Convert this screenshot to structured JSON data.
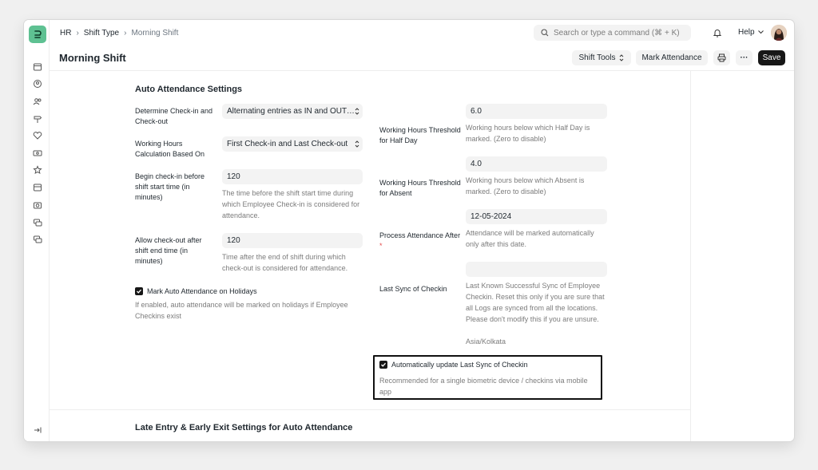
{
  "breadcrumb": [
    "HR",
    "Shift Type",
    "Morning Shift"
  ],
  "search": {
    "placeholder": "Search or type a command (⌘ + K)"
  },
  "help_label": "Help",
  "page_title": "Morning Shift",
  "actions": {
    "shift_tools": "Shift Tools",
    "mark_attendance": "Mark Attendance",
    "more": "···",
    "save": "Save"
  },
  "section": {
    "title": "Auto Attendance Settings",
    "next_title": "Late Entry & Early Exit Settings for Auto Attendance"
  },
  "left_fields": [
    {
      "label": "Determine Check-in and Check-out",
      "value": "Alternating entries as IN and OUT during the same shift"
    },
    {
      "label": "Working Hours Calculation Based On",
      "value": "First Check-in and Last Check-out"
    },
    {
      "label": "Begin check-in before shift start time (in minutes)",
      "value": "120",
      "desc": "The time before the shift start time during which Employee Check-in is considered for attendance."
    },
    {
      "label": "Allow check-out after shift end time (in minutes)",
      "value": "120",
      "desc": "Time after the end of shift during which check-out is considered for attendance."
    }
  ],
  "holiday_check": {
    "label": "Mark Auto Attendance on Holidays",
    "desc": "If enabled, auto attendance will be marked on holidays if Employee Checkins exist"
  },
  "right_fields": [
    {
      "label": "Working Hours Threshold for Half Day",
      "value": "6.0",
      "desc": "Working hours below which Half Day is marked. (Zero to disable)"
    },
    {
      "label": "Working Hours Threshold for Absent",
      "value": "4.0",
      "desc": "Working hours below which Absent is marked. (Zero to disable)"
    },
    {
      "label": "Process Attendance After",
      "required": "*",
      "value": "12-05-2024",
      "desc": "Attendance will be marked automatically only after this date."
    },
    {
      "label": "Last Sync of Checkin",
      "value": "",
      "desc": "Last Known Successful Sync of Employee Checkin. Reset this only if you are sure that all Logs are synced from all the locations. Please don't modify this if you are unsure.",
      "timezone": "Asia/Kolkata"
    }
  ],
  "auto_update_check": {
    "label": "Automatically update Last Sync of Checkin",
    "desc": "Recommended for a single biometric device / checkins via mobile app"
  },
  "colors": {
    "logo": "#5ec192",
    "primary_button": "#171717",
    "field_bg": "#f3f3f3"
  },
  "sidebar_icons": [
    "box-icon",
    "user-circle-icon",
    "users-icon",
    "signpost-icon",
    "heart-pulse-icon",
    "money-icon",
    "star-icon",
    "archive-icon",
    "camera-icon",
    "stack-icon",
    "stack-icon",
    "collapse-sidebar-icon"
  ]
}
